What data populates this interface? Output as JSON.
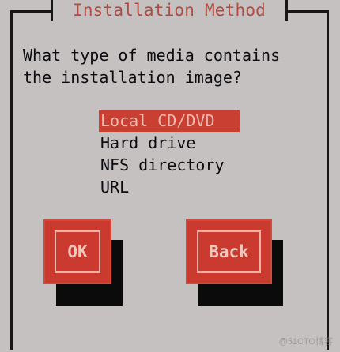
{
  "dialog": {
    "title": "Installation Method",
    "prompt": "What type of media contains\nthe installation image?",
    "media_options": [
      {
        "label": "Local CD/DVD",
        "selected": true
      },
      {
        "label": "Hard drive",
        "selected": false
      },
      {
        "label": "NFS directory",
        "selected": false
      },
      {
        "label": "URL",
        "selected": false
      }
    ],
    "buttons": {
      "ok_label": "OK",
      "back_label": "Back"
    }
  },
  "colors": {
    "background": "#c4c1c0",
    "accent": "#cb3a2e",
    "title_text": "#b44a3f",
    "selected_text": "#efbab0",
    "frame": "#161616"
  },
  "watermark": {
    "text": "@51CTO博客"
  }
}
